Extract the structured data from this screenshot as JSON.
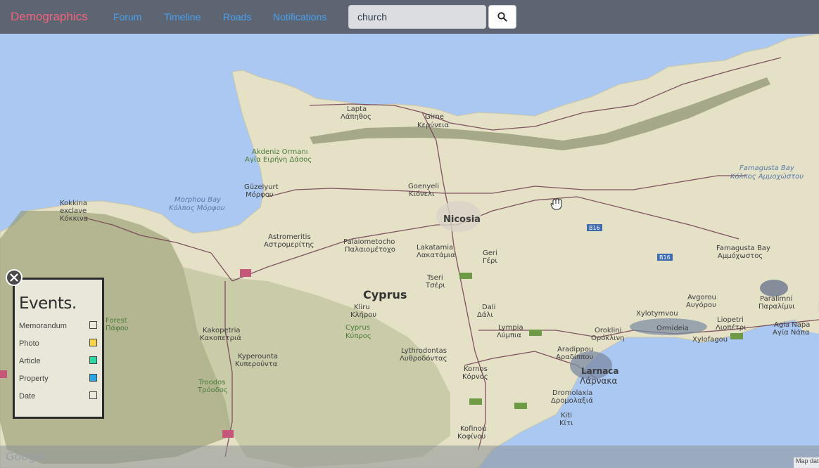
{
  "navbar": {
    "brand": "Demographics",
    "links": [
      "Forum",
      "Timeline",
      "Roads",
      "Notifications"
    ]
  },
  "search": {
    "value": "church"
  },
  "events": {
    "title": "Events.",
    "items": [
      {
        "label": "Memorandum",
        "color": "#ece9dc"
      },
      {
        "label": "Photo",
        "color": "#f5d547"
      },
      {
        "label": "Article",
        "color": "#2ed8a3"
      },
      {
        "label": "Property",
        "color": "#2aa6e6"
      },
      {
        "label": "Date",
        "color": "#ece9dc"
      }
    ]
  },
  "map": {
    "labels": {
      "lapta": "Lapta",
      "lapithos": "Λάπηθος",
      "girne": "Girne",
      "keryneia": "Κερύνεια",
      "akdeniz": "Akdeniz Ormanı",
      "agia_eirini": "Αγία Ειρήνη Δάσος",
      "kokkina1": "Kokkina",
      "kokkina2": "exclave",
      "kokkina3": "Κόκκινα",
      "morphou_bay": "Morphou Bay",
      "morphou_bay_gr": "Κόλπος Μόρφου",
      "guzelyurt": "Güzelyurt",
      "morfou": "Μόρφου",
      "goenyeli": "Goenyeli",
      "gonyeli_gr": "Κιόνελι",
      "nicosia": "Nicosia",
      "astromeritis": "Astromeritis",
      "astromeritis_gr": "Αστρομερίτης",
      "palaiometocho": "Palaiometocho",
      "palaiometocho_gr": "Παλαιομέτοχο",
      "lakatamia": "Lakatamia",
      "lakatamia_gr": "Λακατάμια",
      "geri": "Geri",
      "geri_gr": "Γέρι",
      "tseri": "Tseri",
      "tseri_gr": "Τσέρι",
      "cyprus": "Cyprus",
      "kliru": "Kliru",
      "kliru_gr": "Κλήρου",
      "cyprus2": "Cyprus",
      "cyprus2_gr": "Κύπρος",
      "dali": "Dali",
      "dali_gr": "Δάλι",
      "lympia": "Lympia",
      "lympia_gr": "Λύμπια",
      "kakopetria": "Kakopetria",
      "kakopetria_gr": "Κακοπετριά",
      "kyperounta": "Kyperounta",
      "kyperounta_gr": "Κυπερούντα",
      "troodos": "Troodos",
      "troodos_gr": "Τρόοδος",
      "forest": "Forest",
      "pafou": "Πάφου",
      "lythrodontas": "Lythrodontas",
      "lythrodontas_gr": "Λυθροδόντας",
      "kornos": "Kornos",
      "kornos_gr": "Κόρνος",
      "kofinou": "Kofinou",
      "kofinou_gr": "Κοφίνου",
      "dromolaxia": "Dromolaxia",
      "dromolaxia_gr": "Δρομολαξιά",
      "kiti": "Kiti",
      "kiti_gr": "Κίτι",
      "larnaca": "Larnaca",
      "larnaca_gr": "Λάρνακα",
      "aradippou": "Aradippou",
      "aradippou_gr": "Αραδίππου",
      "oroklini": "Oroklini",
      "oroklini_gr": "Ορόκλινη",
      "xylotymvou": "Xylotymvou",
      "ormideia": "Ormideia",
      "avgorou": "Avgorou",
      "avgorou_gr": "Αυγόρου",
      "liopetri": "Liopetri",
      "liopetri_gr": "Λιοπέτρι",
      "paralimni": "Paralimni",
      "paralimni_gr": "Παραλίμνι",
      "agia_napa": "Agia Napa",
      "agia_napa_gr": "Αγία Νάπα",
      "xylofagou": "Xylofagou",
      "famagusta_bay1": "Famagusta Bay",
      "famagusta_bay1_gr": "Κόλπος Αμμοχώστου",
      "famagusta_bay2": "Famagusta Bay",
      "famagusta_bay2_gr": "Αμμόχωστος",
      "b16": "B16"
    },
    "google": "Google",
    "map_data": "Map data"
  }
}
